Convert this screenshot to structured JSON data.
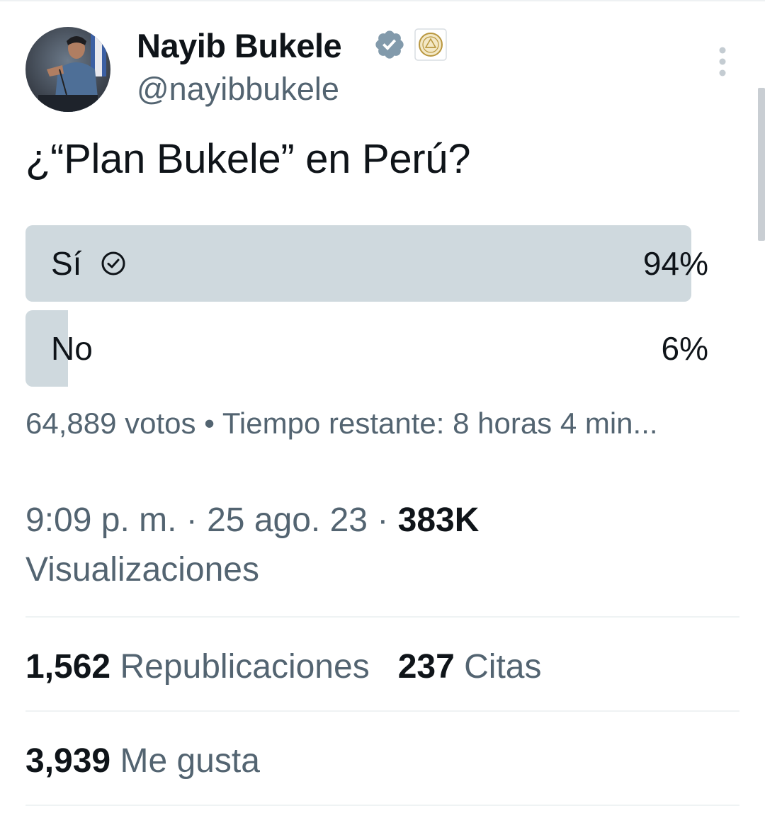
{
  "tweet": {
    "author": {
      "name": "Nayib Bukele",
      "handle": "@nayibbukele",
      "avatar": "person-at-podium-photo"
    },
    "badges": [
      "verified-check-icon",
      "government-seal-icon"
    ],
    "text": "¿“Plan Bukele” en Perú?",
    "poll": {
      "options": [
        {
          "label": "Sí",
          "percent": "94%",
          "fraction": 0.94,
          "voted": true
        },
        {
          "label": "No",
          "percent": "6%",
          "fraction": 0.06,
          "voted": false
        }
      ],
      "votes": "64,889 votos",
      "separator": "•",
      "time_remaining": "Tiempo restante: 8 horas 4 min..."
    },
    "meta": {
      "time_date": "9:09 p. m. · 25 ago. 23 · ",
      "views_count": "383K",
      "views_label": "Visualizaciones"
    },
    "stats": {
      "reposts_count": "1,562",
      "reposts_label": "Republicaciones",
      "quotes_count": "237",
      "quotes_label": "Citas",
      "likes_count": "3,939",
      "likes_label": "Me gusta"
    }
  },
  "colors": {
    "text": "#0f1419",
    "secondary": "#536471",
    "poll_bar": "#cfd9de",
    "verified": "#829aab",
    "divider": "#eff3f4"
  }
}
